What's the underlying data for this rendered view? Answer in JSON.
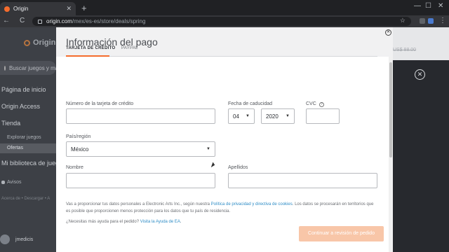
{
  "browser": {
    "tab_title": "Origin",
    "tab_close": "✕",
    "new_tab": "+",
    "url_host": "origin.com",
    "url_path": "/mex/es-es/store/deals/spring",
    "back": "←",
    "reload": "C"
  },
  "sidebar": {
    "logo": "Origin",
    "search_placeholder": "Buscar juegos y más",
    "items": [
      "Página de inicio",
      "Origin Access",
      "Tienda"
    ],
    "store_sub": [
      "Explorar juegos",
      "Ofertas"
    ],
    "library": "Mi biblioteca de juegos",
    "avisos": "Avisos",
    "footer": "Acerca de • Descargar • A",
    "username": "jmedicis"
  },
  "background": {
    "price": "US$ 88.00"
  },
  "modal": {
    "title": "Información del pago",
    "tabs": [
      "TARJETA DE CRÉDITO",
      "PAYPAL"
    ],
    "card_number_label": "Número de la tarjeta de crédito",
    "expiry_label": "Fecha de caducidad",
    "expiry_month": "04",
    "expiry_year": "2020",
    "cvc_label": "CVC",
    "cvc_help": "?",
    "country_label": "País/región",
    "country_value": "México",
    "first_name_label": "Nombre",
    "last_name_label": "Apellidos",
    "legal_pre": "Vas a proporcionar tus datos personales a Electronic Arts Inc., según nuestra ",
    "legal_link": "Política de privacidad y directiva de cookies",
    "legal_post": ". Los datos se procesarán en territorios que es posible que proporcionen menos protección para los datos que tu país de residencia.",
    "help_pre": "¿Necesitas más ayuda para el pedido? ",
    "help_link": "Visita la Ayuda de EA",
    "help_post": ".",
    "continue_button": "Continuar a revisión de pedido"
  },
  "colors": {
    "accent": "#f56c2d",
    "link": "#2f8dc6",
    "button_disabled": "#f8c6a8"
  }
}
